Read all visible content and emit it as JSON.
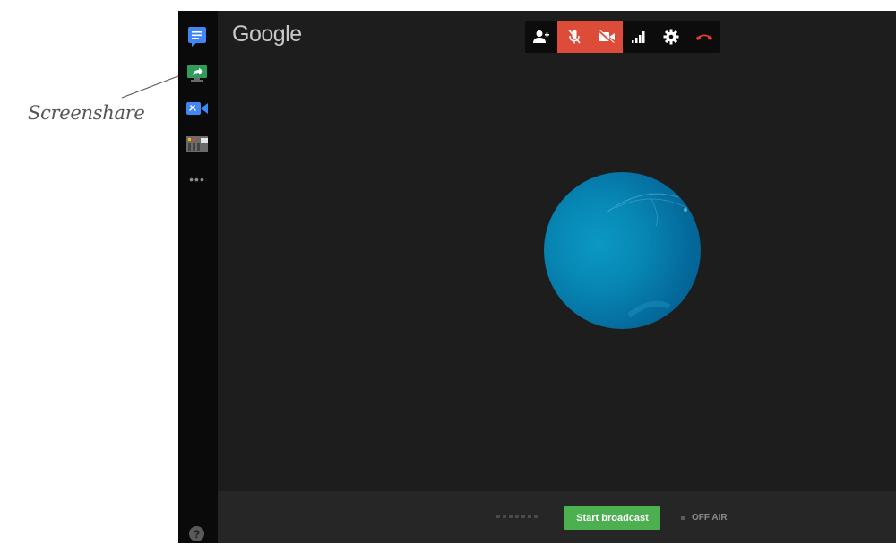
{
  "annotation": {
    "label": "Screenshare"
  },
  "app": {
    "logo": "Google"
  },
  "sidebar": {
    "items": [
      {
        "icon": "chat-icon"
      },
      {
        "icon": "screenshare-icon"
      },
      {
        "icon": "camera-settings-icon"
      },
      {
        "icon": "control-room-icon"
      }
    ],
    "more": "•••",
    "help": "?"
  },
  "toolbar": {
    "buttons": [
      {
        "icon": "add-person-icon"
      },
      {
        "icon": "mic-off-icon",
        "active": true
      },
      {
        "icon": "video-off-icon",
        "active": true
      },
      {
        "icon": "signal-icon"
      },
      {
        "icon": "gear-icon"
      },
      {
        "icon": "hangup-icon"
      }
    ]
  },
  "footer": {
    "broadcast_label": "Start broadcast",
    "status": "OFF AIR"
  },
  "colors": {
    "accent_red": "#dd4b39",
    "broadcast_green": "#4caf50",
    "hangup_red": "#e53935"
  }
}
